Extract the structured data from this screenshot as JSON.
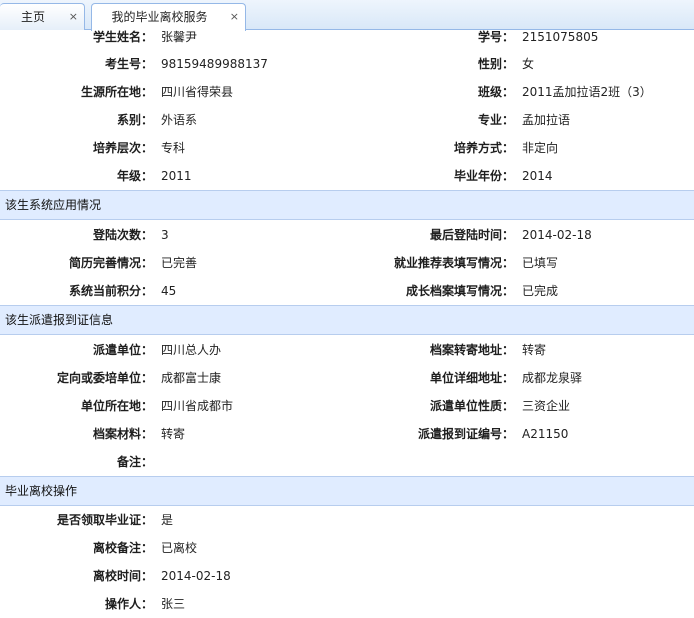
{
  "tabs": [
    {
      "label": "主页",
      "close": "×"
    },
    {
      "label": "我的毕业离校服务",
      "close": "×"
    }
  ],
  "student": [
    {
      "left_label": "学生姓名：",
      "left_value": "张馨尹",
      "right_label": "学号：",
      "right_value": "2151075805"
    },
    {
      "left_label": "考生号：",
      "left_value": "98159489988137",
      "right_label": "性别：",
      "right_value": "女"
    },
    {
      "left_label": "生源所在地：",
      "left_value": "四川省得荣县",
      "right_label": "班级：",
      "right_value": "2011孟加拉语2班（3）"
    },
    {
      "left_label": "系别：",
      "left_value": "外语系",
      "right_label": "专业：",
      "right_value": "孟加拉语"
    },
    {
      "left_label": "培养层次：",
      "left_value": "专科",
      "right_label": "培养方式：",
      "right_value": "非定向"
    },
    {
      "left_label": "年级：",
      "left_value": "2011",
      "right_label": "毕业年份：",
      "right_value": "2014"
    }
  ],
  "system_usage": {
    "title": "该生系统应用情况",
    "rows": [
      {
        "left_label": "登陆次数：",
        "left_value": "3",
        "right_label": "最后登陆时间：",
        "right_value": "2014-02-18"
      },
      {
        "left_label": "简历完善情况：",
        "left_value": "已完善",
        "right_label": "就业推荐表填写情况：",
        "right_value": "已填写"
      },
      {
        "left_label": "系统当前积分：",
        "left_value": "45",
        "right_label": "成长档案填写情况：",
        "right_value": "已完成"
      }
    ]
  },
  "dispatch": {
    "title": "该生派遣报到证信息",
    "rows": [
      {
        "left_label": "派遣单位：",
        "left_value": "四川总人办",
        "right_label": "档案转寄地址：",
        "right_value": "转寄"
      },
      {
        "left_label": "定向或委培单位：",
        "left_value": "成都富士康",
        "right_label": "单位详细地址：",
        "right_value": "成都龙泉驿"
      },
      {
        "left_label": "单位所在地：",
        "left_value": "四川省成都市",
        "right_label": "派遣单位性质：",
        "right_value": "三资企业"
      },
      {
        "left_label": "档案材料：",
        "left_value": "转寄",
        "right_label": "派遣报到证编号：",
        "right_value": "A21150"
      },
      {
        "left_label": "备注：",
        "left_value": "",
        "right_label": "",
        "right_value": ""
      }
    ]
  },
  "leaving": {
    "title": "毕业离校操作",
    "rows": [
      {
        "label": "是否领取毕业证：",
        "value": "是"
      },
      {
        "label": "离校备注：",
        "value": "已离校"
      },
      {
        "label": "离校时间：",
        "value": "2014-02-18"
      },
      {
        "label": "操作人：",
        "value": "张三"
      }
    ]
  }
}
